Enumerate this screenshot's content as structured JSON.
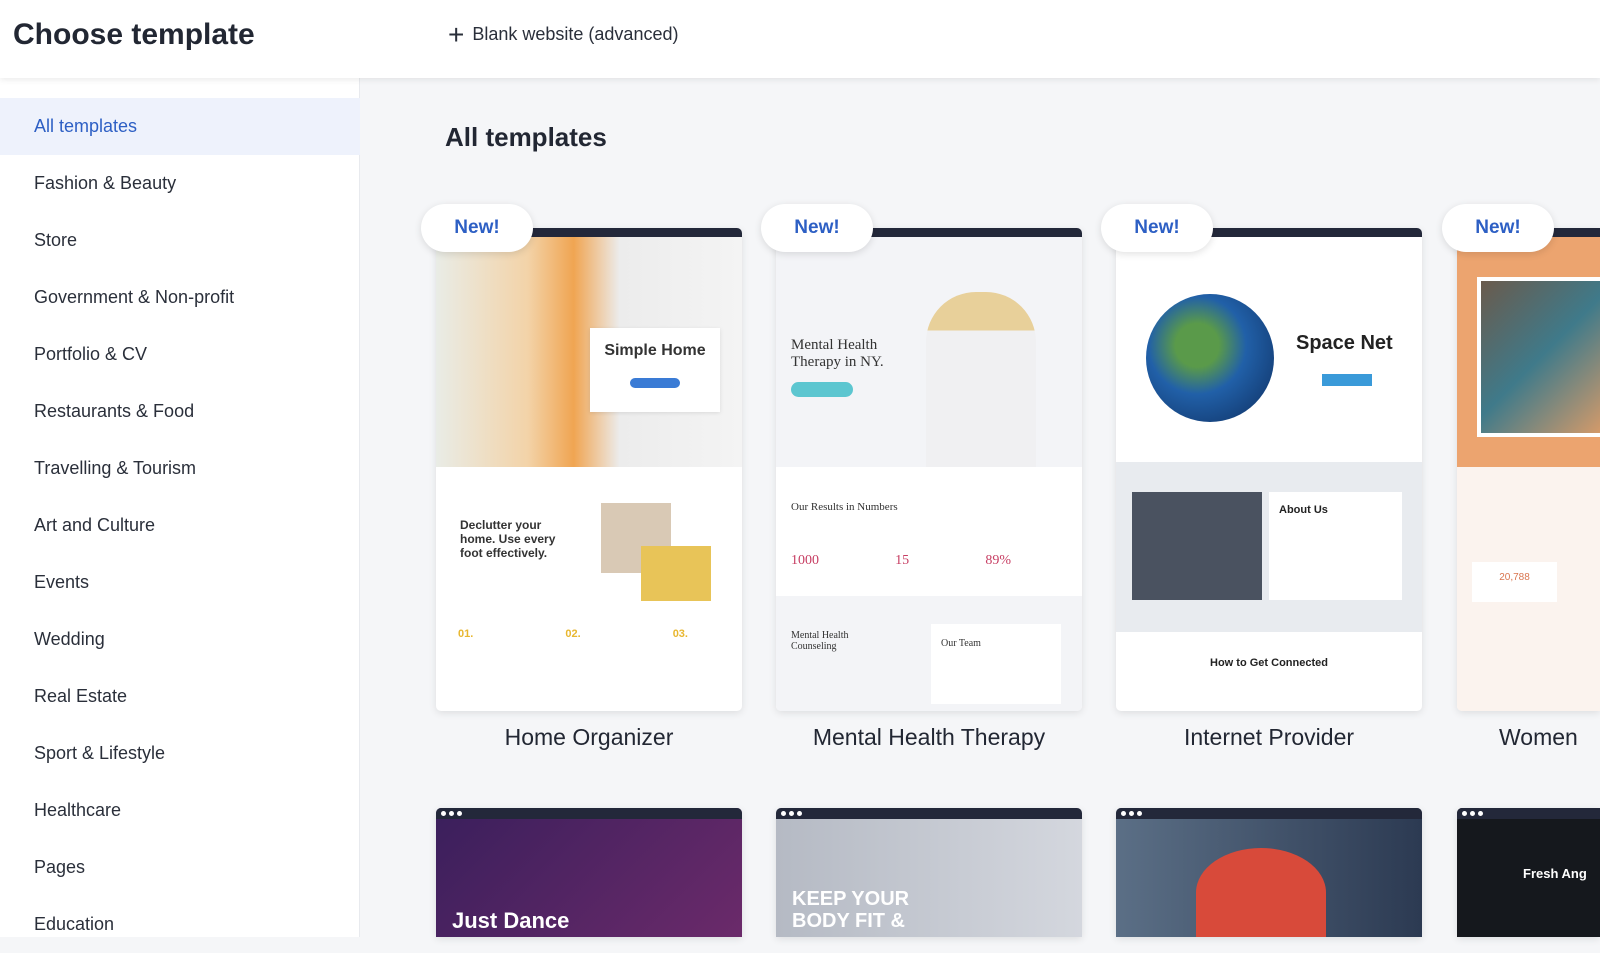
{
  "header": {
    "title": "Choose template",
    "blank_label": "Blank website (advanced)",
    "blank_icon": "plus-icon"
  },
  "sidebar": {
    "items": [
      {
        "label": "All templates",
        "active": true
      },
      {
        "label": "Fashion & Beauty"
      },
      {
        "label": "Store"
      },
      {
        "label": "Government & Non-profit"
      },
      {
        "label": "Portfolio & CV"
      },
      {
        "label": "Restaurants & Food"
      },
      {
        "label": "Travelling & Tourism"
      },
      {
        "label": "Art and Culture"
      },
      {
        "label": "Events"
      },
      {
        "label": "Wedding"
      },
      {
        "label": "Real Estate"
      },
      {
        "label": "Sport & Lifestyle"
      },
      {
        "label": "Healthcare"
      },
      {
        "label": "Pages"
      },
      {
        "label": "Education"
      }
    ]
  },
  "main": {
    "title": "All templates",
    "badge": "New!",
    "cards": [
      {
        "name": "Home Organizer",
        "headline": "Simple Home",
        "sub": "Declutter your home. Use every foot effectively.",
        "steps": [
          "01.",
          "02.",
          "03."
        ]
      },
      {
        "name": "Mental Health Therapy",
        "headline": "Mental Health Therapy in NY.",
        "sub": "Our Results in Numbers",
        "stats": [
          "1000",
          "15",
          "89%"
        ],
        "section": "Mental Health Counseling",
        "team": "Our Team"
      },
      {
        "name": "Internet Provider",
        "headline": "Space Net",
        "sub": "About Us",
        "section": "How to Get Connected"
      },
      {
        "name": "Women",
        "stat": "20,788"
      }
    ],
    "row2": [
      {
        "headline": "Just Dance"
      },
      {
        "headline": "KEEP YOUR BODY FIT &"
      },
      {
        "headline": ""
      },
      {
        "headline": "Fresh Ang"
      }
    ]
  },
  "colors": {
    "accent": "#2d5fc4",
    "active_bg": "#eef2fc",
    "page_bg": "#f5f6f8"
  }
}
